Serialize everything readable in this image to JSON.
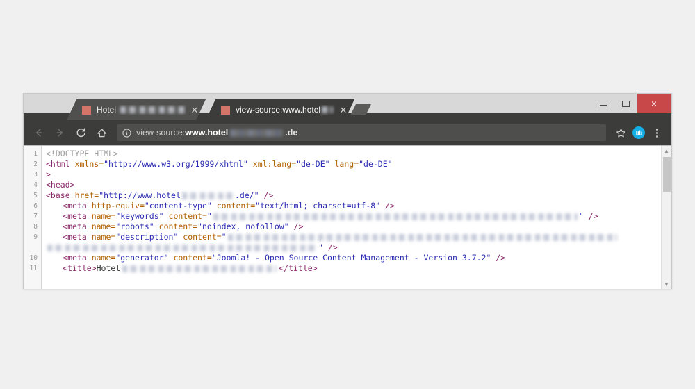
{
  "page": {
    "background_color": "#f0f0f0"
  },
  "window": {
    "controls": {
      "minimize_label": "Minimize",
      "maximize_label": "Maximize",
      "close_label": "×",
      "close_color": "#c8484a"
    }
  },
  "tabs": [
    {
      "title": "Hotel",
      "redacted": true,
      "active": false,
      "close_label": "✕",
      "favicon": "site-favicon"
    },
    {
      "title": "view-source:www.hotel",
      "redacted": true,
      "active": true,
      "close_label": "✕",
      "favicon": "site-favicon"
    }
  ],
  "new_tab_button": {
    "label": "New tab"
  },
  "toolbar": {
    "back_label": "Back",
    "forward_label": "Forward",
    "reload_label": "Reload",
    "home_label": "Home",
    "bookmark_label": "Bookmark this page",
    "extension_label": "extension-icon",
    "menu_label": "Customize and control"
  },
  "omnibox": {
    "info_icon": "info-circle-icon",
    "scheme": "view-source:",
    "host": "www.hotel",
    "redacted": true,
    "tld": ".de"
  },
  "source": {
    "line_numbers": [
      "1",
      "2",
      "3",
      "4",
      "5",
      "6",
      "7",
      "8",
      "9",
      "10",
      "11"
    ],
    "lines": [
      {
        "n": "1",
        "text": "<!DOCTYPE HTML>"
      },
      {
        "n": "2",
        "text": "<html xmlns=\"http://www.w3.org/1999/xhtml\" xml:lang=\"de-DE\" lang=\"de-DE\""
      },
      {
        "n": "3",
        "text": ">"
      },
      {
        "n": "4",
        "text": "<head>"
      },
      {
        "n": "5",
        "text": "<base href=\"http://www.hotel          .de/\" />"
      },
      {
        "n": "6",
        "text": "    <meta http-equiv=\"content-type\" content=\"text/html; charset=utf-8\" />"
      },
      {
        "n": "7",
        "text": "    <meta name=\"keywords\" content=\"\" />"
      },
      {
        "n": "8",
        "text": "    <meta name=\"robots\" content=\"noindex, nofollow\" />"
      },
      {
        "n": "9",
        "text": "    <meta name=\"description\" content=\"\" />"
      },
      {
        "n": "10",
        "text": "    <meta name=\"generator\" content=\"Joomla! - Open Source Content Management - Version 3.7.2\" />"
      },
      {
        "n": "11",
        "text": "    <title>Hotel          </title>"
      }
    ],
    "tokens": {
      "doctype": "<!DOCTYPE HTML>",
      "html_tag": "<html",
      "xmlns_attr": "xmlns=",
      "xmlns_val": "\"http://www.w3.org/1999/xhtml\"",
      "xmllang_attr": "xml:lang=",
      "xmllang_val": "\"de-DE\"",
      "lang_attr": "lang=",
      "lang_val": "\"de-DE\"",
      "gt": ">",
      "head_tag": "<head>",
      "base_tag": "<base",
      "href_attr": "href=",
      "base_url_prefix": "http://www.hotel",
      "base_url_suffix": ".de/",
      "selfclose": "/>",
      "meta_tag": "<meta",
      "httpequiv_attr": "http-equiv=",
      "httpequiv_val": "\"content-type\"",
      "content_attr": "content=",
      "contenttype_val": "\"text/html; charset=utf-8\"",
      "name_attr": "name=",
      "keywords_val": "\"keywords\"",
      "robots_val": "\"robots\"",
      "robots_content": "\"noindex, nofollow\"",
      "description_val": "\"description\"",
      "generator_val": "\"generator\"",
      "generator_content": "\"Joomla! - Open Source Content Management - Version 3.7.2\"",
      "title_open": "<title>",
      "title_text": "Hotel",
      "title_close": "</title>",
      "quote": "\"",
      "dq_open": "\""
    },
    "highlight": {
      "target_line": "8",
      "color": "#c0392b",
      "note": "robots meta tag highlighted"
    },
    "scrollbar": {
      "up_arrow": "▲",
      "down_arrow": "▼"
    }
  }
}
